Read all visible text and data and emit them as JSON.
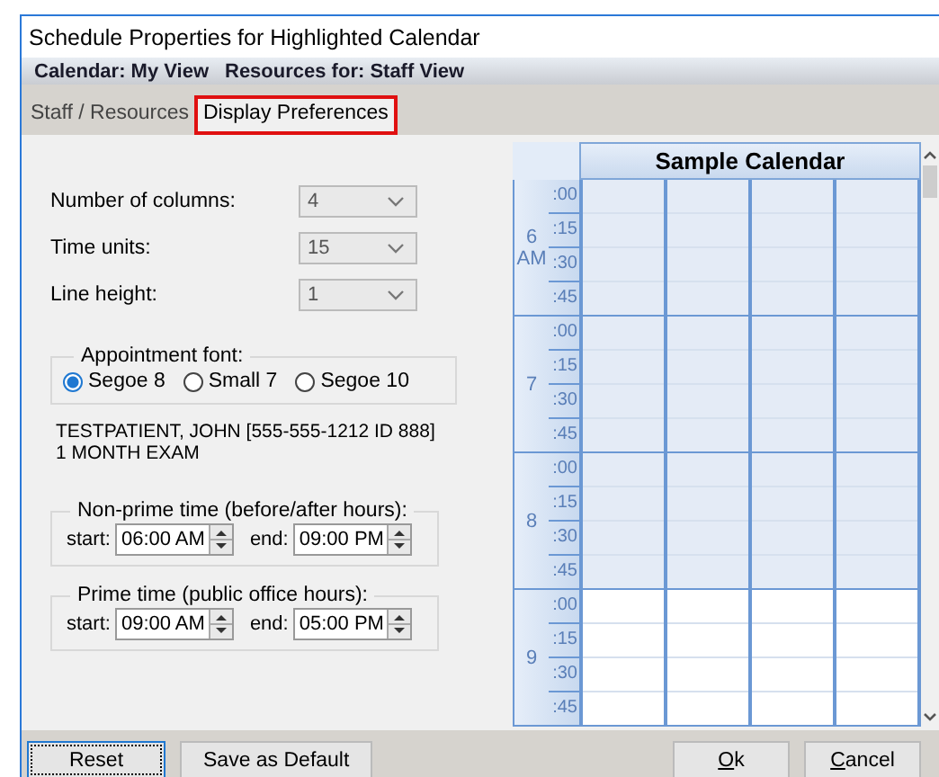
{
  "window": {
    "title": "Schedule Properties for Highlighted Calendar"
  },
  "info_bar": {
    "calendar": "Calendar: My View",
    "resources": "Resources for: Staff View"
  },
  "tabs": [
    {
      "label": "Staff / Resources",
      "selected": false,
      "highlighted": false
    },
    {
      "label": "Display Preferences",
      "selected": true,
      "highlighted": true
    }
  ],
  "settings": [
    {
      "label": "Number of columns:",
      "value": "4"
    },
    {
      "label": "Time units:",
      "value": "15"
    },
    {
      "label": "Line height:",
      "value": "1"
    }
  ],
  "appointment_font": {
    "legend": "Appointment font:",
    "options": [
      {
        "label": "Segoe 8",
        "selected": true
      },
      {
        "label": "Small 7",
        "selected": false
      },
      {
        "label": "Segoe 10",
        "selected": false
      }
    ]
  },
  "preview": [
    "TESTPATIENT, JOHN [555-555-1212 ID 888]",
    "1 MONTH EXAM"
  ],
  "time_ranges": [
    {
      "legend": "Non-prime time (before/after hours):",
      "start_label": "start:",
      "start": "06:00 AM",
      "end_label": "end:",
      "end": "09:00 PM"
    },
    {
      "legend": "Prime time (public office hours):",
      "start_label": "start:",
      "start": "09:00 AM",
      "end_label": "end:",
      "end": "05:00 PM"
    }
  ],
  "calendar": {
    "title": "Sample Calendar",
    "hours": [
      {
        "hour": "6",
        "suffix": "AM",
        "prime": false,
        "minutes": [
          ":00",
          ":15",
          ":30",
          ":45"
        ]
      },
      {
        "hour": "7",
        "prime": false,
        "minutes": [
          ":00",
          ":15",
          ":30",
          ":45"
        ]
      },
      {
        "hour": "8",
        "prime": false,
        "minutes": [
          ":00",
          ":15",
          ":30",
          ":45"
        ]
      },
      {
        "hour": "9",
        "prime": true,
        "minutes": [
          ":00",
          ":15",
          ":30",
          ":45"
        ]
      }
    ]
  },
  "buttons_left": [
    {
      "label": "Reset",
      "focused": true
    },
    {
      "label": "Save as Default",
      "focused": false
    }
  ],
  "buttons_right": [
    {
      "label": "Ok",
      "focused": false
    },
    {
      "label": "Cancel",
      "focused": false
    }
  ]
}
